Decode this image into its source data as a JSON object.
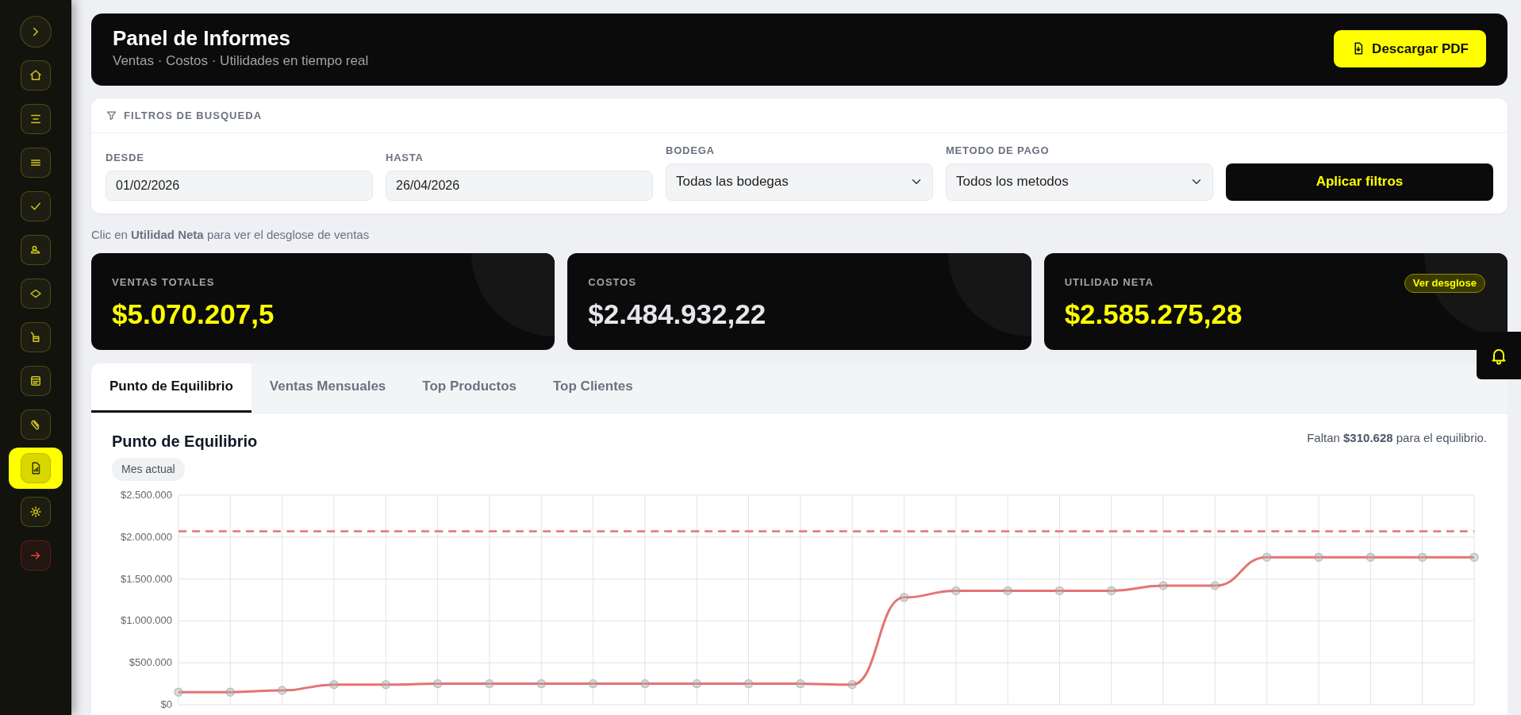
{
  "sidebar": {
    "items": [
      {
        "kind": "toggle",
        "selected": false
      },
      {
        "kind": "link",
        "selected": false
      },
      {
        "kind": "link",
        "selected": false
      },
      {
        "kind": "link",
        "selected": false
      },
      {
        "kind": "link",
        "selected": false
      },
      {
        "kind": "link",
        "selected": false
      },
      {
        "kind": "link",
        "selected": false
      },
      {
        "kind": "link",
        "selected": false
      },
      {
        "kind": "link",
        "selected": false
      },
      {
        "kind": "link",
        "selected": false
      },
      {
        "kind": "link",
        "selected": true
      },
      {
        "kind": "link",
        "selected": false
      },
      {
        "kind": "logout",
        "selected": false
      }
    ]
  },
  "header": {
    "title": "Panel de Informes",
    "subtitle": "Ventas · Costos · Utilidades en tiempo real",
    "button": "Descargar PDF"
  },
  "filters": {
    "title": "FILTROS DE BUSQUEDA",
    "fields": [
      {
        "kind": "input",
        "label": "DESDE",
        "value": "01/02/2026"
      },
      {
        "kind": "input",
        "label": "HASTA",
        "value": "26/04/2026"
      },
      {
        "kind": "select",
        "label": "BODEGA",
        "value": "Todas las bodegas"
      },
      {
        "kind": "select",
        "label": "METODO DE PAGO",
        "value": "Todos los metodos"
      }
    ],
    "apply_button": "Aplicar filtros"
  },
  "hint": "Clic en **Utilidad Neta** para ver el desglose de ventas",
  "stats": [
    {
      "label": "VENTAS TOTALES",
      "value": "$5.070.207,5",
      "color": "#ffff00"
    },
    {
      "label": "COSTOS",
      "value": "$2.484.932,22",
      "color": "#e5e7eb"
    },
    {
      "label": "UTILIDAD NETA",
      "value": "$2.585.275,28",
      "color": "#ffff00",
      "action": "Ver desglose"
    }
  ],
  "tabs": [
    {
      "label": "Punto de Equilibrio",
      "selected": true
    },
    {
      "label": "Ventas Mensuales",
      "selected": false
    },
    {
      "label": "Top Productos",
      "selected": false
    },
    {
      "label": "Top Clientes",
      "selected": false
    }
  ],
  "panel": {
    "title": "Punto de Equilibrio",
    "badge": "Mes actual",
    "note": "Faltan **$310.628** para el equilibrio.",
    "chart_data": {
      "type": "line",
      "grid": true,
      "ylim": [
        0,
        2500000
      ],
      "yticks": [
        {
          "value": 0,
          "label": "$0"
        },
        {
          "value": 500000,
          "label": "$500.000"
        },
        {
          "value": 1000000,
          "label": "$1.000.000"
        },
        {
          "value": 1500000,
          "label": "$1.500.000"
        },
        {
          "value": 2000000,
          "label": "$2.000.000"
        },
        {
          "value": 2500000,
          "label": "$2.500.000"
        }
      ],
      "series": [
        {
          "color": "#e57373",
          "line_style": "solid",
          "marker": true,
          "values": [
            150000,
            150000,
            170000,
            240000,
            240000,
            250000,
            250000,
            250000,
            250000,
            250000,
            250000,
            250000,
            250000,
            240000,
            1280000,
            1360000,
            1360000,
            1360000,
            1360000,
            1420000,
            1420000,
            1760000,
            1760000,
            1760000,
            1760000,
            1760000
          ]
        },
        {
          "color": "#e57373",
          "line_style": "dashed",
          "marker": false,
          "values": [
            2070000,
            2070000,
            2070000,
            2070000,
            2070000,
            2070000,
            2070000,
            2070000,
            2070000,
            2070000,
            2070000,
            2070000,
            2070000,
            2070000,
            2070000,
            2070000,
            2070000,
            2070000,
            2070000,
            2070000,
            2070000,
            2070000,
            2070000,
            2070000,
            2070000,
            2070000
          ]
        }
      ]
    }
  },
  "bell": {
    "visible": true
  }
}
